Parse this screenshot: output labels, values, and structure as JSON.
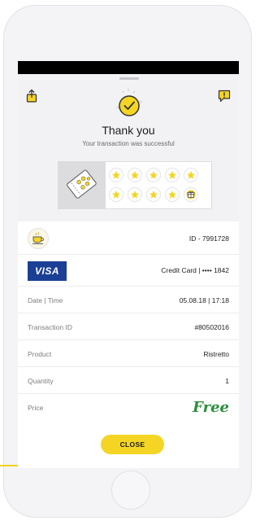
{
  "header": {
    "share_icon": "share-icon",
    "report_icon": "report-icon",
    "status_icon": "check-icon",
    "title": "Thank you",
    "subtitle": "Your transaction was successful"
  },
  "loyalty_card": {
    "ticket_icon": "ticket-icon",
    "stars_filled": 9,
    "stars_total": 9,
    "reward_icon": "gift-icon"
  },
  "details": {
    "transaction_ref": "ID - 7991728",
    "payment_method": "Credit Card | •••• 1842",
    "card_brand": "VISA",
    "rows": [
      {
        "label": "Date | Time",
        "value": "05.08.18 | 17:18"
      },
      {
        "label": "Transaction ID",
        "value": "#80502016"
      },
      {
        "label": "Product",
        "value": "Ristretto"
      },
      {
        "label": "Quantity",
        "value": "1"
      },
      {
        "label": "Price",
        "value": "Free"
      }
    ]
  },
  "actions": {
    "close_label": "CLOSE"
  },
  "colors": {
    "accent": "#f4d524",
    "price_free": "#2c8d3c",
    "visa_blue": "#1a3f95"
  }
}
